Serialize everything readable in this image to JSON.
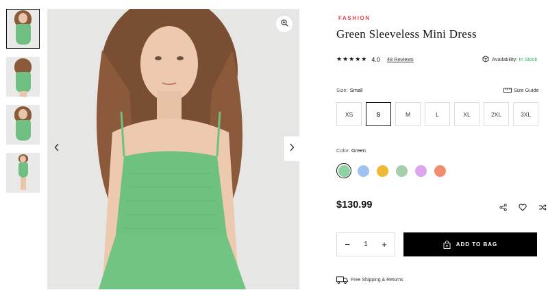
{
  "product": {
    "brand": "FASHION",
    "title": "Green Sleeveless Mini Dress",
    "rating": "4.0",
    "reviews_label": "48 Reviews",
    "availability_label": "Availability:",
    "availability_value": "In Stock",
    "price": "$130.99"
  },
  "sizes": {
    "label": "Size:",
    "selected": "Small",
    "guide_label": "Size Guide",
    "options": [
      "XS",
      "S",
      "M",
      "L",
      "XL",
      "2XL",
      "3XL"
    ]
  },
  "colors": {
    "label": "Color:",
    "selected": "Green",
    "swatches": [
      "#8ed1a2",
      "#9ec3f1",
      "#f0b935",
      "#a5ceac",
      "#dca6ee",
      "#f28c71"
    ]
  },
  "cart": {
    "quantity": "1",
    "minus": "−",
    "plus": "+",
    "add_label": "ADD TO BAG"
  },
  "shipping_label": "Free Shipping & Returns",
  "icons": {
    "zoom": "zoom-in-icon",
    "prev": "chevron-left-icon",
    "next": "chevron-right-icon",
    "share": "share-icon",
    "wishlist": "heart-icon",
    "compare": "shuffle-icon",
    "bag": "bag-icon",
    "truck": "truck-icon",
    "box": "box-icon",
    "ruler": "ruler-icon"
  }
}
